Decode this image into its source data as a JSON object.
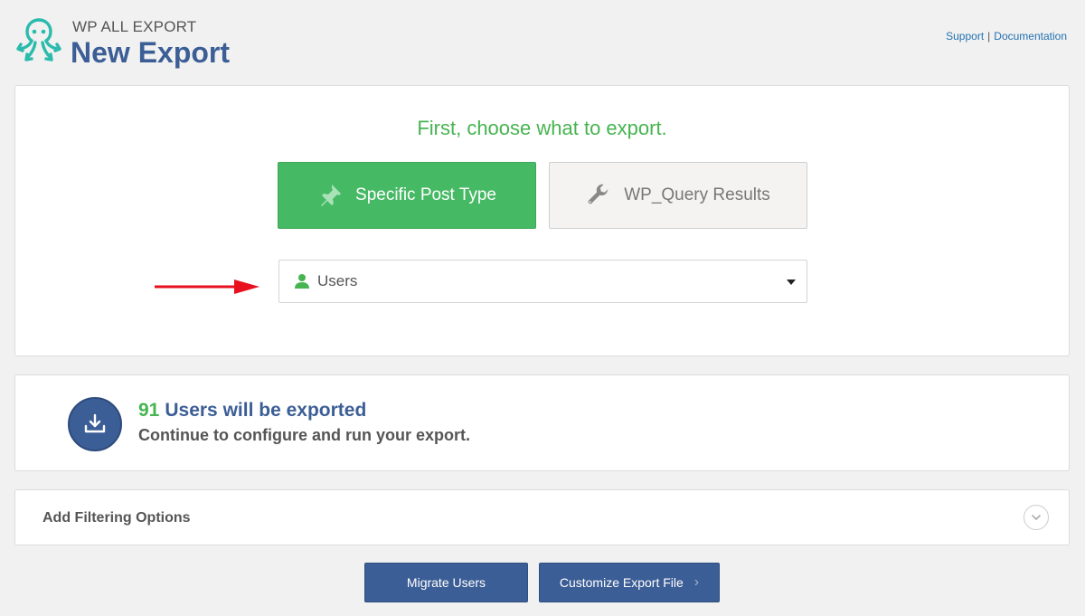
{
  "header": {
    "brand_small": "WP ALL EXPORT",
    "title": "New Export",
    "support_link": "Support",
    "separator": "|",
    "documentation_link": "Documentation"
  },
  "choose": {
    "heading": "First, choose what to export.",
    "specific_post_type": "Specific Post Type",
    "wp_query_results": "WP_Query Results",
    "selected_type": "Users"
  },
  "summary": {
    "count": "91",
    "count_label": "Users will be exported",
    "subtext": "Continue to configure and run your export."
  },
  "filter": {
    "label": "Add Filtering Options"
  },
  "actions": {
    "migrate": "Migrate Users",
    "customize": "Customize Export File"
  },
  "colors": {
    "brand_blue": "#3c5e96",
    "green": "#46b450",
    "button_green": "#46b965",
    "arrow_red": "#e8101e",
    "logo_teal": "#2bbbad"
  },
  "icons": {
    "logo": "octopus-logo-icon",
    "post_type": "pushpin-icon",
    "wp_query": "wrench-icon",
    "user": "user-icon",
    "export": "download-icon",
    "filter_toggle": "chevron-down-icon",
    "customize_next": "chevron-right-icon",
    "pointer": "red-arrow-icon"
  }
}
